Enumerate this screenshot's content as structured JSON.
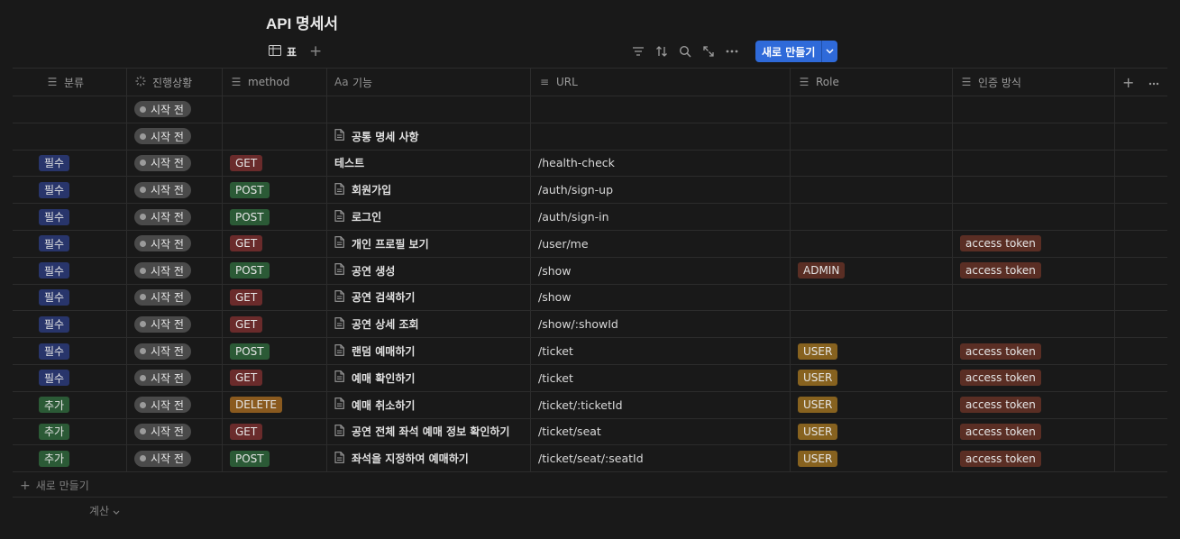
{
  "page": {
    "title": "API 명세서"
  },
  "view": {
    "tab_label": "표",
    "tab_icon": "table-icon",
    "add_icon": "plus-icon"
  },
  "toolbar": {
    "icons": [
      "filter-icon",
      "sort-icon",
      "search-icon",
      "expand-icon",
      "more-icon"
    ],
    "new_label": "새로 만들기",
    "accent": "#2f6ad9"
  },
  "columns": [
    {
      "label": "분류",
      "icon": "list-icon"
    },
    {
      "label": "진행상황",
      "icon": "status-icon"
    },
    {
      "label": "method",
      "icon": "list-icon"
    },
    {
      "label": "기능",
      "icon": "title-icon"
    },
    {
      "label": "URL",
      "icon": "text-icon"
    },
    {
      "label": "Role",
      "icon": "list-icon"
    },
    {
      "label": "인증 방식",
      "icon": "list-icon"
    }
  ],
  "colors": {
    "필수": "#28356b",
    "추가": "#2b5a36",
    "GET": "#6a2b2b",
    "POST": "#2b5a36",
    "DELETE": "#8a5a1f",
    "ADMIN": "#5a2e24",
    "USER": "#87621f",
    "access token": "#5a2e24"
  },
  "rows": [
    {
      "category": "",
      "status": "시작 전",
      "method": "",
      "name": "",
      "doc": false,
      "url": "",
      "role": "",
      "auth": ""
    },
    {
      "category": "",
      "status": "시작 전",
      "method": "",
      "name": "공통 명세 사항",
      "doc": true,
      "url": "",
      "role": "",
      "auth": ""
    },
    {
      "category": "필수",
      "status": "시작 전",
      "method": "GET",
      "name": "테스트",
      "doc": false,
      "url": "/health-check",
      "role": "",
      "auth": ""
    },
    {
      "category": "필수",
      "status": "시작 전",
      "method": "POST",
      "name": "회원가입",
      "doc": true,
      "url": "/auth/sign-up",
      "role": "",
      "auth": ""
    },
    {
      "category": "필수",
      "status": "시작 전",
      "method": "POST",
      "name": "로그인",
      "doc": true,
      "url": "/auth/sign-in",
      "role": "",
      "auth": ""
    },
    {
      "category": "필수",
      "status": "시작 전",
      "method": "GET",
      "name": "개인 프로필 보기",
      "doc": true,
      "url": "/user/me",
      "role": "",
      "auth": "access token"
    },
    {
      "category": "필수",
      "status": "시작 전",
      "method": "POST",
      "name": "공연 생성",
      "doc": true,
      "url": "/show",
      "role": "ADMIN",
      "auth": "access token"
    },
    {
      "category": "필수",
      "status": "시작 전",
      "method": "GET",
      "name": "공연 검색하기",
      "doc": true,
      "url": "/show",
      "role": "",
      "auth": ""
    },
    {
      "category": "필수",
      "status": "시작 전",
      "method": "GET",
      "name": "공연 상세 조회",
      "doc": true,
      "url": "/show/:showId",
      "role": "",
      "auth": ""
    },
    {
      "category": "필수",
      "status": "시작 전",
      "method": "POST",
      "name": "랜덤 예매하기",
      "doc": true,
      "url": "/ticket",
      "role": "USER",
      "auth": "access token"
    },
    {
      "category": "필수",
      "status": "시작 전",
      "method": "GET",
      "name": "예매 확인하기",
      "doc": true,
      "url": "/ticket",
      "role": "USER",
      "auth": "access token"
    },
    {
      "category": "추가",
      "status": "시작 전",
      "method": "DELETE",
      "name": "예매 취소하기",
      "doc": true,
      "url": "/ticket/:ticketId",
      "role": "USER",
      "auth": "access token"
    },
    {
      "category": "추가",
      "status": "시작 전",
      "method": "GET",
      "name": "공연 전체 좌석 예매 정보 확인하기",
      "doc": true,
      "url": "/ticket/seat",
      "role": "USER",
      "auth": "access token"
    },
    {
      "category": "추가",
      "status": "시작 전",
      "method": "POST",
      "name": "좌석을 지정하여 예매하기",
      "doc": true,
      "url": "/ticket/seat/:seatId",
      "role": "USER",
      "auth": "access token"
    }
  ],
  "footer": {
    "add_row_label": "새로 만들기",
    "calc_label": "계산"
  }
}
